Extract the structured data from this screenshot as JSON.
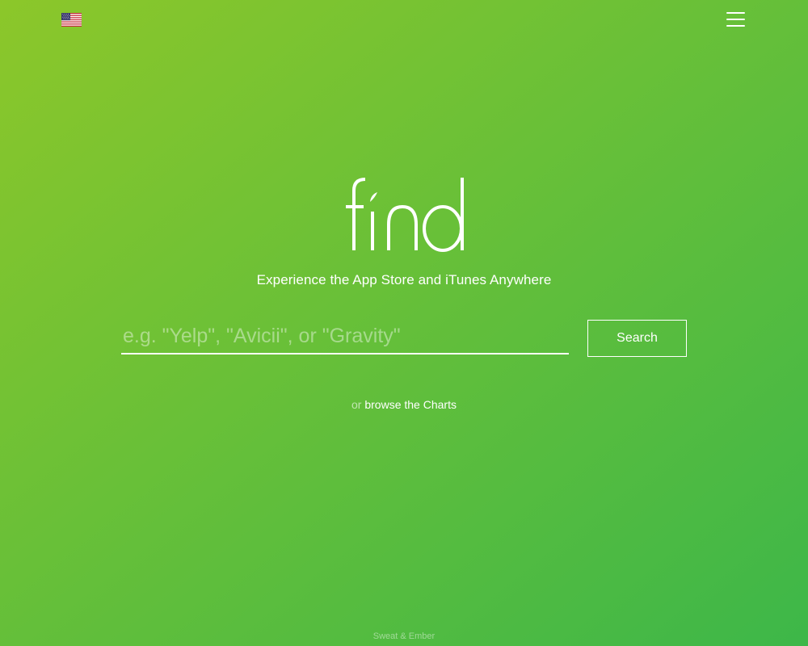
{
  "colors": {
    "gradient_start": "#8cc72a",
    "gradient_end": "#3db749",
    "foreground": "#ffffff"
  },
  "header": {
    "country_flag_icon": "us-flag-icon",
    "menu_icon": "hamburger-menu-icon"
  },
  "logo": {
    "text": "find"
  },
  "tagline": "Experience the App Store and iTunes Anywhere",
  "search": {
    "value": "",
    "placeholder": "e.g. \"Yelp\", \"Avicii\", or \"Gravity\"",
    "button_label": "Search"
  },
  "browse": {
    "prefix": "or",
    "link_text": "browse the Charts"
  },
  "footer": {
    "credit": "Sweat & Ember"
  }
}
